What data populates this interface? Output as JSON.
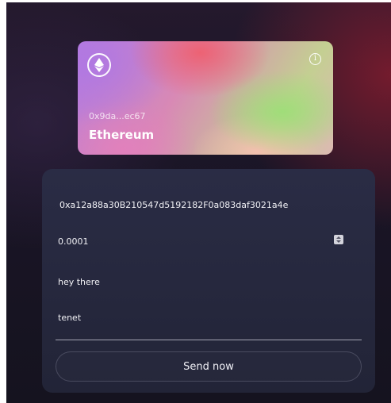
{
  "wallet_card": {
    "address": "0x9da...ec67",
    "network": "Ethereum",
    "logo_icon": "ethereum-icon",
    "info_icon": "info-icon",
    "info_glyph": "i"
  },
  "send_form": {
    "recipient": "0xa12a88a30B210547d5192182F0a083daf3021a4e",
    "amount": "0.0001",
    "message": "hey there",
    "name": "tenet",
    "send_label": "Send now"
  },
  "colors": {
    "background": "#1a1526",
    "form_background": "#2a2c45",
    "text": "#f2f2f6"
  }
}
